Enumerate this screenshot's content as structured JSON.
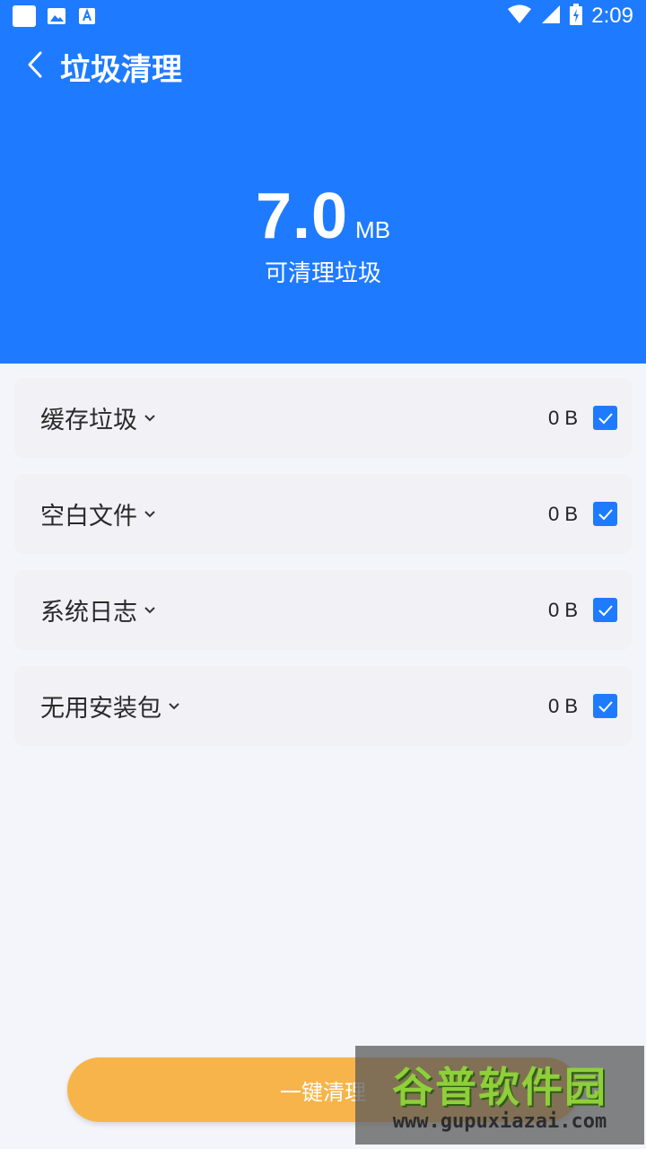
{
  "status_bar": {
    "time": "2:09"
  },
  "header": {
    "title": "垃圾清理",
    "size_value": "7.0",
    "size_unit": "MB",
    "size_label": "可清理垃圾"
  },
  "items": [
    {
      "label": "缓存垃圾",
      "size": "0 B",
      "checked": true
    },
    {
      "label": "空白文件",
      "size": "0 B",
      "checked": true
    },
    {
      "label": "系统日志",
      "size": "0 B",
      "checked": true
    },
    {
      "label": "无用安装包",
      "size": "0 B",
      "checked": true
    }
  ],
  "clean_button": {
    "label": "一键清理"
  },
  "watermark": {
    "brand": "谷普软件园",
    "url": "www.gupuxiazai.com"
  },
  "colors": {
    "header_bg": "#1e7bff",
    "button_bg": "#f7b44a",
    "page_bg": "#f4f5fa"
  }
}
